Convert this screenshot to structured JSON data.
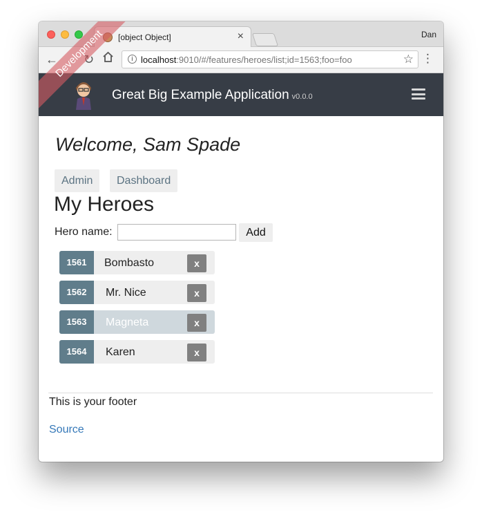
{
  "browser": {
    "tab_title": "[object Object]",
    "tab_close": "×",
    "profile_name": "Dan",
    "url_host": "localhost",
    "url_rest": ":9010/#/features/heroes/list;id=1563;foo=foo",
    "back_icon": "arrow-left",
    "forward_icon": "arrow-right",
    "reload_icon": "reload",
    "home_icon": "home",
    "bookmark_icon": "star",
    "menu_icon": "vertical-dots"
  },
  "app": {
    "brand": "Great Big Example Application",
    "version": "v0.0.0",
    "ribbon": "Development",
    "menu_icon": "hamburger"
  },
  "content": {
    "welcome": "Welcome, Sam Spade",
    "nav_links": [
      "Admin",
      "Dashboard"
    ],
    "heading": "My Heroes",
    "hero_name_label": "Hero name:",
    "hero_name_value": "",
    "add_label": "Add",
    "heroes": [
      {
        "id": "1561",
        "name": "Bombasto",
        "delete": "x",
        "selected": false
      },
      {
        "id": "1562",
        "name": "Mr. Nice",
        "delete": "x",
        "selected": false
      },
      {
        "id": "1563",
        "name": "Magneta",
        "delete": "x",
        "selected": true
      },
      {
        "id": "1564",
        "name": "Karen",
        "delete": "x",
        "selected": false
      }
    ]
  },
  "footer": {
    "text": "This is your footer",
    "source_link": "Source"
  },
  "colors": {
    "navbar": "#373d46",
    "hero_id_badge": "#607d8b",
    "selected_hero": "#cfd8dd",
    "delete_button": "#808080",
    "ribbon": "#d55c62",
    "link": "#3578b8"
  }
}
